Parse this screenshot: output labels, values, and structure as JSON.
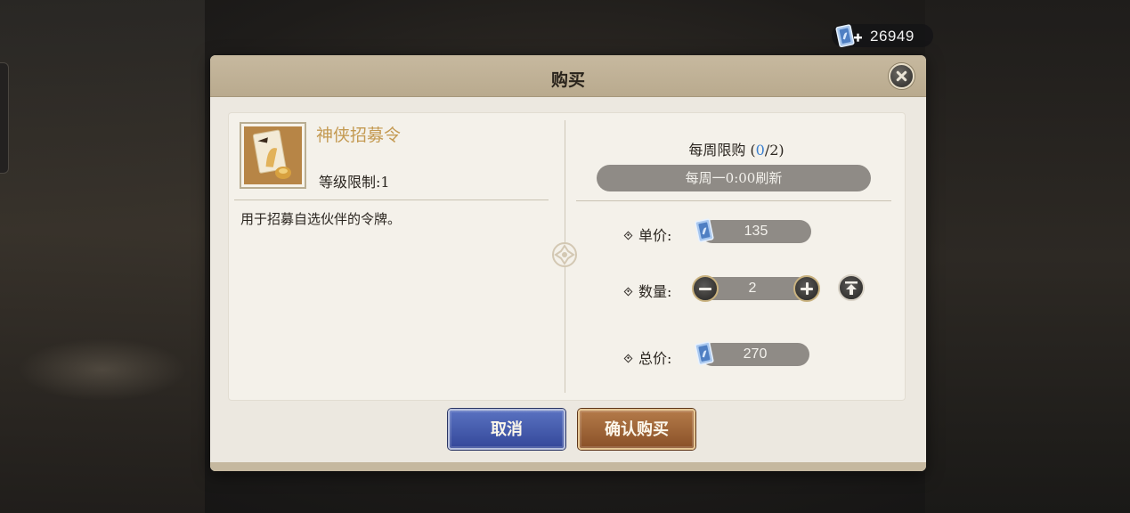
{
  "currency": {
    "icon": "recruit-ticket-icon",
    "value": "26949"
  },
  "dialog": {
    "title": "购买",
    "item": {
      "name": "神侠招募令",
      "level_limit": "等级限制:1",
      "description": "用于招募自选伙伴的令牌。"
    },
    "weekly_limit": {
      "prefix": "每周限购 (",
      "current": "0",
      "suffix": "/2)"
    },
    "refresh_text": "每周一0:00刷新",
    "unit_price": {
      "label": "单价:",
      "value": "135"
    },
    "quantity": {
      "label": "数量:",
      "value": "2"
    },
    "total_price": {
      "label": "总价:",
      "value": "270"
    },
    "buttons": {
      "cancel": "取消",
      "confirm": "确认购买"
    }
  },
  "colors": {
    "item_name": "#c49a52",
    "weekly_current": "#3a7fcf",
    "cancel_button": "#3c52a4",
    "confirm_button": "#9a5f33"
  }
}
